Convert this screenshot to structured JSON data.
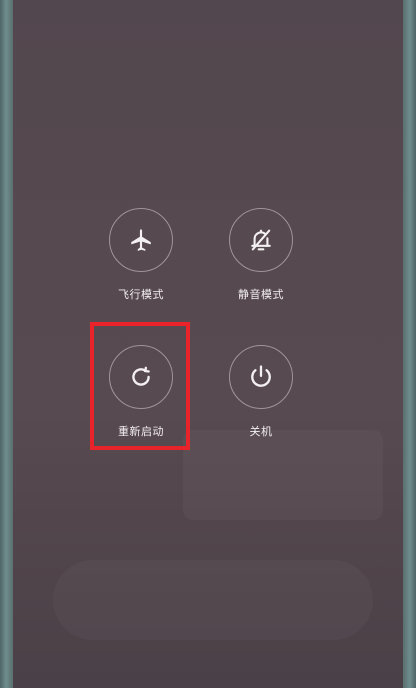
{
  "power_menu": {
    "items": [
      {
        "label": "飞行模式",
        "icon": "airplane-icon"
      },
      {
        "label": "静音模式",
        "icon": "bell-off-icon"
      },
      {
        "label": "重新启动",
        "icon": "restart-icon"
      },
      {
        "label": "关机",
        "icon": "power-icon"
      }
    ],
    "highlight_color": "#e8242a"
  }
}
